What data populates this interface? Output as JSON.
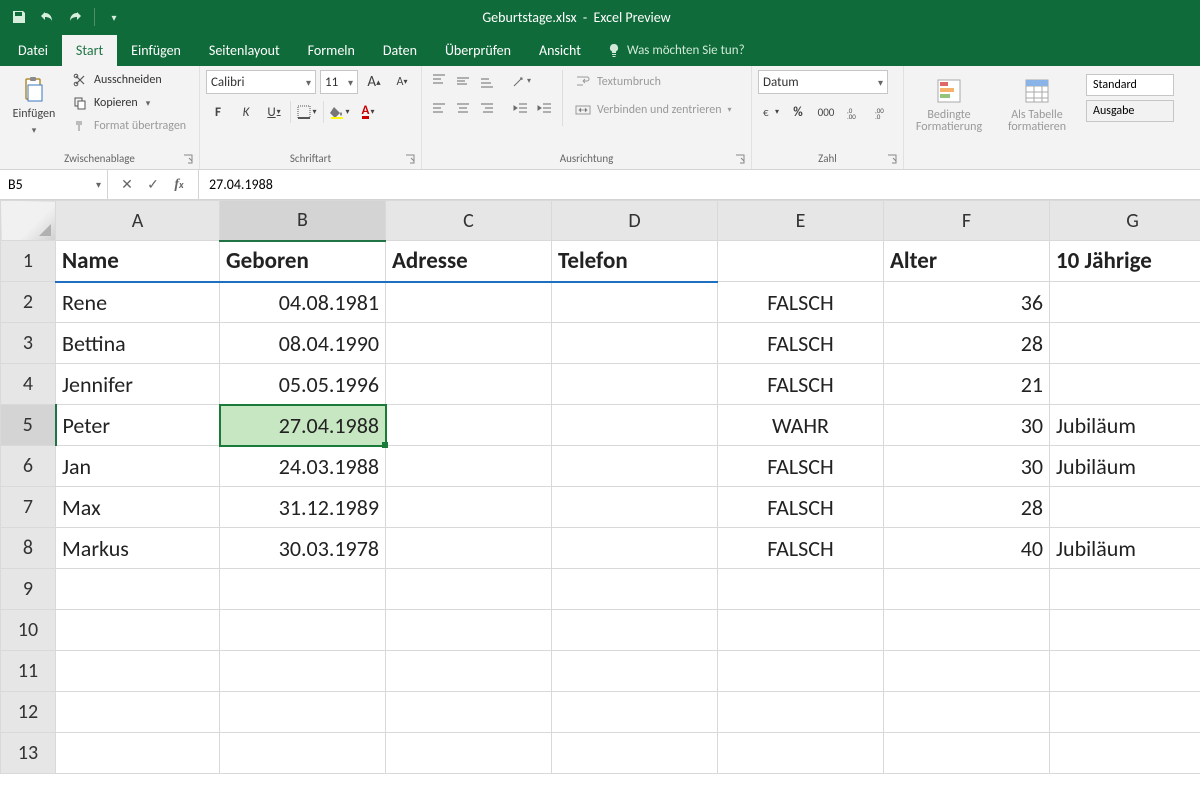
{
  "titlebar": {
    "filename": "Geburtstage.xlsx",
    "appname": "Excel Preview"
  },
  "tabs": {
    "datei": "Datei",
    "start": "Start",
    "einfuegen": "Einfügen",
    "seitenlayout": "Seitenlayout",
    "formeln": "Formeln",
    "daten": "Daten",
    "ueberpruefen": "Überprüfen",
    "ansicht": "Ansicht",
    "tell_me": "Was möchten Sie tun?"
  },
  "ribbon": {
    "clipboard": {
      "paste": "Einfügen",
      "cut": "Ausschneiden",
      "copy": "Kopieren",
      "format_painter": "Format übertragen",
      "group_label": "Zwischenablage"
    },
    "font": {
      "font_name": "Calibri",
      "font_size": "11",
      "bold": "F",
      "italic": "K",
      "underline": "U",
      "group_label": "Schriftart"
    },
    "alignment": {
      "wrap": "Textumbruch",
      "merge": "Verbinden und zentrieren",
      "group_label": "Ausrichtung"
    },
    "number": {
      "format": "Datum",
      "group_label": "Zahl"
    },
    "styles": {
      "cond_fmt": "Bedingte Formatierung",
      "as_table": "Als Tabelle formatieren",
      "std": "Standard",
      "output": "Ausgabe"
    }
  },
  "formula_bar": {
    "cell_ref": "B5",
    "value": "27.04.1988"
  },
  "columns": [
    "A",
    "B",
    "C",
    "D",
    "E",
    "F",
    "G"
  ],
  "selection": {
    "col": "B",
    "row": 5
  },
  "header_row": {
    "A": "Name",
    "B": "Geboren",
    "C": "Adresse",
    "D": "Telefon",
    "E": "",
    "F": "Alter",
    "G": "10 Jährige"
  },
  "rows": [
    {
      "n": 2,
      "A": "Rene",
      "B": "04.08.1981",
      "C": "",
      "D": "",
      "E": "FALSCH",
      "F": "36",
      "G": ""
    },
    {
      "n": 3,
      "A": "Bettina",
      "B": "08.04.1990",
      "C": "",
      "D": "",
      "E": "FALSCH",
      "F": "28",
      "G": ""
    },
    {
      "n": 4,
      "A": "Jennifer",
      "B": "05.05.1996",
      "C": "",
      "D": "",
      "E": "FALSCH",
      "F": "21",
      "G": ""
    },
    {
      "n": 5,
      "A": "Peter",
      "B": "27.04.1988",
      "C": "",
      "D": "",
      "E": "WAHR",
      "F": "30",
      "G": "Jubiläum"
    },
    {
      "n": 6,
      "A": "Jan",
      "B": "24.03.1988",
      "C": "",
      "D": "",
      "E": "FALSCH",
      "F": "30",
      "G": "Jubiläum"
    },
    {
      "n": 7,
      "A": "Max",
      "B": "31.12.1989",
      "C": "",
      "D": "",
      "E": "FALSCH",
      "F": "28",
      "G": ""
    },
    {
      "n": 8,
      "A": "Markus",
      "B": "30.03.1978",
      "C": "",
      "D": "",
      "E": "FALSCH",
      "F": "40",
      "G": "Jubiläum"
    },
    {
      "n": 9,
      "A": "",
      "B": "",
      "C": "",
      "D": "",
      "E": "",
      "F": "",
      "G": ""
    },
    {
      "n": 10,
      "A": "",
      "B": "",
      "C": "",
      "D": "",
      "E": "",
      "F": "",
      "G": ""
    },
    {
      "n": 11,
      "A": "",
      "B": "",
      "C": "",
      "D": "",
      "E": "",
      "F": "",
      "G": ""
    },
    {
      "n": 12,
      "A": "",
      "B": "",
      "C": "",
      "D": "",
      "E": "",
      "F": "",
      "G": ""
    },
    {
      "n": 13,
      "A": "",
      "B": "",
      "C": "",
      "D": "",
      "E": "",
      "F": "",
      "G": ""
    }
  ]
}
